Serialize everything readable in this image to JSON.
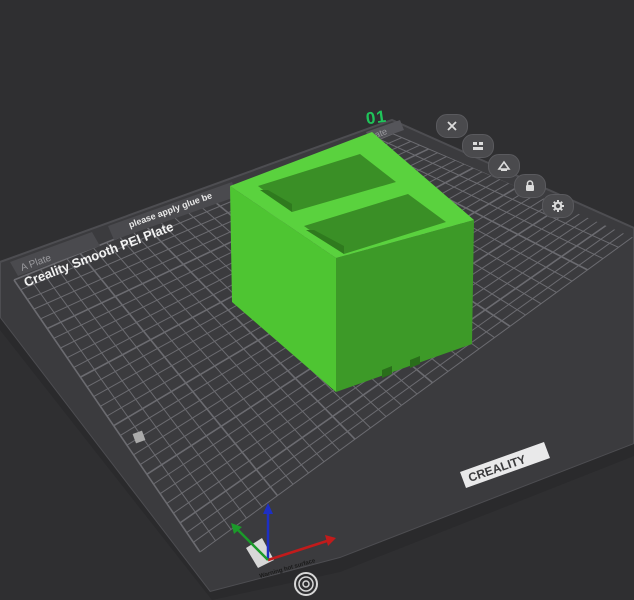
{
  "plate": {
    "number": "01",
    "name_tab": "A Plate",
    "notice_tab": "please apply glue be",
    "right_tab": "ate",
    "bed_label": "Creality Smooth PEI Plate",
    "brand": "CREALITY",
    "warning": "Warning hot surface"
  },
  "toolbar": {
    "close_icon": "close-icon",
    "arrange_icon": "arrange-icon",
    "orient_icon": "orient-icon",
    "lock_icon": "lock-icon",
    "settings_icon": "gear-icon"
  },
  "colors": {
    "background": "#2f2f31",
    "bed": "#3b3b3e",
    "grid": "#6b6b70",
    "model_top": "#5ad23e",
    "model_left": "#4ec532",
    "model_right": "#3d9a28",
    "plate_number": "#1fc45a",
    "axis_x": "#c11b1b",
    "axis_y": "#1b9a2a",
    "axis_z": "#1d2fc4"
  }
}
